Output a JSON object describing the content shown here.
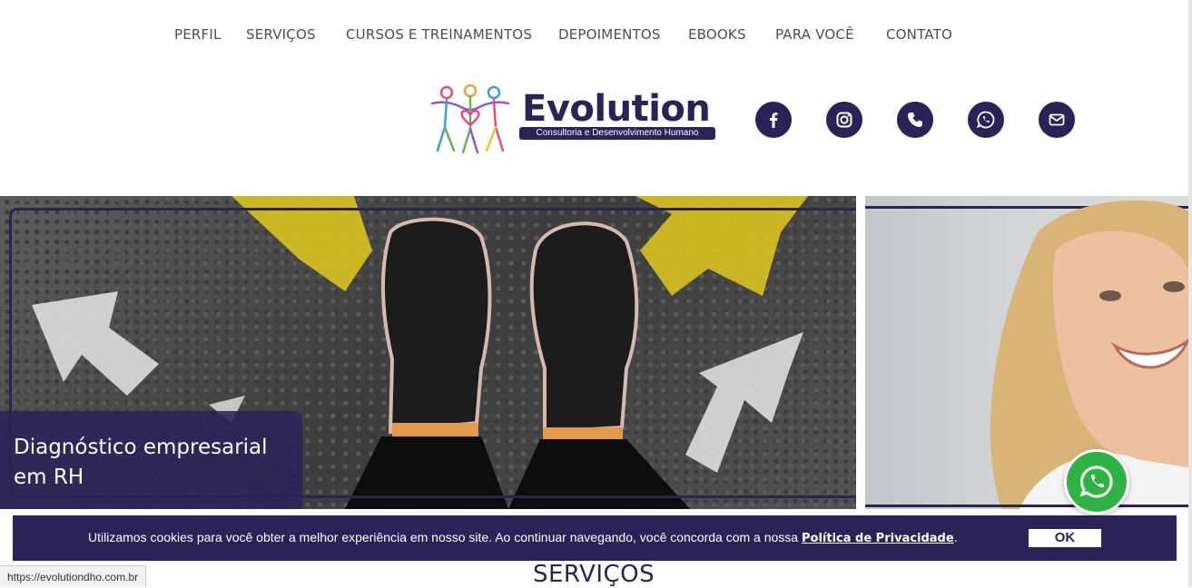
{
  "nav": {
    "items": [
      "PERFIL",
      "SERVIÇOS",
      "CURSOS E TREINAMENTOS",
      "DEPOIMENTOS",
      "EBOOKS",
      "PARA VOCÊ",
      "CONTATO"
    ]
  },
  "logo": {
    "brand": "Evolution",
    "tagline": "Consultoria e Desenvolvimento Humano"
  },
  "social": [
    "facebook-icon",
    "instagram-icon",
    "phone-icon",
    "whatsapp-icon",
    "email-icon"
  ],
  "carousel": {
    "caption": "Diagnóstico empresarial em RH"
  },
  "cookie": {
    "text": "Utilizamos cookies para você obter a melhor experiência em nosso site. Ao continuar navegando, você concorda com a nossa ",
    "link": "Política de Privacidade",
    "suffix": ".",
    "ok": "OK"
  },
  "section": {
    "title": "SERVIÇOS"
  },
  "status_url": "https://evolutiondho.com.br",
  "colors": {
    "brand": "#2b2257",
    "whatsapp": "#2fb344"
  }
}
